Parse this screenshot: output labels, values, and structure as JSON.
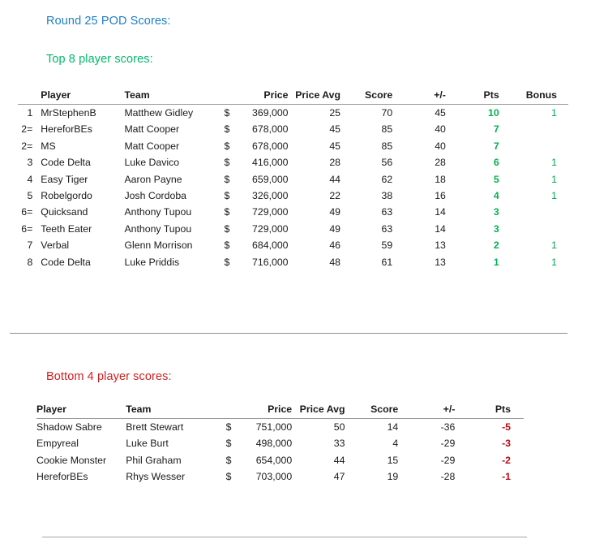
{
  "document": {
    "title": "Round 25 POD Scores:",
    "title_color": "#1f7ec8"
  },
  "sections": {
    "top": {
      "heading": "Top 8 player scores:",
      "heading_color": "#00b96c",
      "columns": {
        "rank": "",
        "player": "Player",
        "team": "Team",
        "currency": "",
        "price": "Price",
        "price_avg": "Price Avg",
        "score": "Score",
        "plus_minus": "+/-",
        "pts": "Pts",
        "bonus": "Bonus"
      },
      "rows": [
        {
          "rank": "1",
          "player": "MrStephenB",
          "team": "Matthew Gidley",
          "currency": "$",
          "price": "369,000",
          "price_avg": "25",
          "score": "70",
          "plus_minus": "45",
          "pts": "10",
          "bonus": "1"
        },
        {
          "rank": "2=",
          "player": "HereforBEs",
          "team": "Matt Cooper",
          "currency": "$",
          "price": "678,000",
          "price_avg": "45",
          "score": "85",
          "plus_minus": "40",
          "pts": "7",
          "bonus": ""
        },
        {
          "rank": "2=",
          "player": "MS",
          "team": "Matt Cooper",
          "currency": "$",
          "price": "678,000",
          "price_avg": "45",
          "score": "85",
          "plus_minus": "40",
          "pts": "7",
          "bonus": ""
        },
        {
          "rank": "3",
          "player": "Code Delta",
          "team": "Luke Davico",
          "currency": "$",
          "price": "416,000",
          "price_avg": "28",
          "score": "56",
          "plus_minus": "28",
          "pts": "6",
          "bonus": "1"
        },
        {
          "rank": "4",
          "player": "Easy Tiger",
          "team": "Aaron Payne",
          "currency": "$",
          "price": "659,000",
          "price_avg": "44",
          "score": "62",
          "plus_minus": "18",
          "pts": "5",
          "bonus": "1"
        },
        {
          "rank": "5",
          "player": "Robelgordo",
          "team": "Josh Cordoba",
          "currency": "$",
          "price": "326,000",
          "price_avg": "22",
          "score": "38",
          "plus_minus": "16",
          "pts": "4",
          "bonus": "1"
        },
        {
          "rank": "6=",
          "player": "Quicksand",
          "team": "Anthony Tupou",
          "currency": "$",
          "price": "729,000",
          "price_avg": "49",
          "score": "63",
          "plus_minus": "14",
          "pts": "3",
          "bonus": ""
        },
        {
          "rank": "6=",
          "player": "Teeth Eater",
          "team": "Anthony Tupou",
          "currency": "$",
          "price": "729,000",
          "price_avg": "49",
          "score": "63",
          "plus_minus": "14",
          "pts": "3",
          "bonus": ""
        },
        {
          "rank": "7",
          "player": "Verbal",
          "team": "Glenn Morrison",
          "currency": "$",
          "price": "684,000",
          "price_avg": "46",
          "score": "59",
          "plus_minus": "13",
          "pts": "2",
          "bonus": "1"
        },
        {
          "rank": "8",
          "player": "Code Delta",
          "team": "Luke Priddis",
          "currency": "$",
          "price": "716,000",
          "price_avg": "48",
          "score": "61",
          "plus_minus": "13",
          "pts": "1",
          "bonus": "1"
        }
      ]
    },
    "bottom": {
      "heading": "Bottom 4 player scores:",
      "heading_color": "#cf2020",
      "columns": {
        "player": "Player",
        "team": "Team",
        "currency": "",
        "price": "Price",
        "price_avg": "Price Avg",
        "score": "Score",
        "plus_minus": "+/-",
        "pts": "Pts"
      },
      "rows": [
        {
          "player": "Shadow Sabre",
          "team": "Brett Stewart",
          "currency": "$",
          "price": "751,000",
          "price_avg": "50",
          "score": "14",
          "plus_minus": "-36",
          "pts": "-5"
        },
        {
          "player": "Empyreal",
          "team": "Luke Burt",
          "currency": "$",
          "price": "498,000",
          "price_avg": "33",
          "score": "4",
          "plus_minus": "-29",
          "pts": "-3"
        },
        {
          "player": "Cookie Monster",
          "team": "Phil Graham",
          "currency": "$",
          "price": "654,000",
          "price_avg": "44",
          "score": "15",
          "plus_minus": "-29",
          "pts": "-2"
        },
        {
          "player": "HereforBEs",
          "team": "Rhys Wesser",
          "currency": "$",
          "price": "703,000",
          "price_avg": "47",
          "score": "19",
          "plus_minus": "-28",
          "pts": "-1"
        }
      ]
    }
  },
  "colors": {
    "positive_points": "#00b251",
    "negative_points": "#b80d18",
    "bonus": "#00a84a",
    "rule": "#8f8f94"
  }
}
